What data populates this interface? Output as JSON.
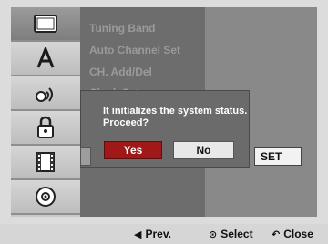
{
  "sidebar": {
    "items": [
      {
        "icon": "tv-screen-icon",
        "active": true
      },
      {
        "icon": "letter-a-icon",
        "active": false
      },
      {
        "icon": "audio-icon",
        "active": false
      },
      {
        "icon": "lock-icon",
        "active": false
      },
      {
        "icon": "film-icon",
        "active": false
      },
      {
        "icon": "disc-icon",
        "active": false
      }
    ]
  },
  "menu": {
    "items": [
      "Tuning Band",
      "Auto Channel Set",
      "CH. Add/Del",
      "Clock Set"
    ]
  },
  "dialog": {
    "message": "It initializes the system status. Proceed?",
    "yes_label": "Yes",
    "no_label": "No"
  },
  "panel": {
    "set_label": "SET"
  },
  "bottom": {
    "prev_label": "Prev.",
    "select_label": "Select",
    "close_label": "Close"
  },
  "colors": {
    "accent_yes": "#a01818",
    "menu_bg": "#6d6d6d",
    "panel_bg": "#898989"
  }
}
